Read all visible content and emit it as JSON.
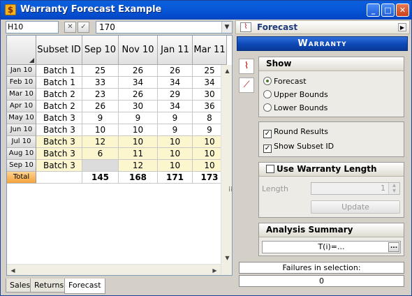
{
  "window": {
    "title": "Warranty Forecast Example",
    "minimize": "_",
    "maximize": "□",
    "close": "✕"
  },
  "formula_bar": {
    "cell_ref": "H10",
    "cancel": "✕",
    "accept": "✓",
    "value": "170"
  },
  "sheet": {
    "columns": [
      "Subset ID",
      "Sep 10",
      "Nov 10",
      "Jan 11",
      "Mar 11"
    ],
    "rows": [
      {
        "label": "Jan 10",
        "cells": [
          "Batch 1",
          "25",
          "26",
          "26",
          "25"
        ]
      },
      {
        "label": "Feb 10",
        "cells": [
          "Batch 1",
          "33",
          "34",
          "34",
          "34"
        ]
      },
      {
        "label": "Mar 10",
        "cells": [
          "Batch 2",
          "23",
          "26",
          "29",
          "30"
        ]
      },
      {
        "label": "Apr 10",
        "cells": [
          "Batch 2",
          "26",
          "30",
          "34",
          "36"
        ]
      },
      {
        "label": "May 10",
        "cells": [
          "Batch 3",
          "9",
          "9",
          "9",
          "8"
        ]
      },
      {
        "label": "Jun 10",
        "cells": [
          "Batch 3",
          "10",
          "10",
          "9",
          "9"
        ]
      },
      {
        "label": "Jul 10",
        "cells": [
          "Batch 3",
          "12",
          "10",
          "10",
          "10"
        ]
      },
      {
        "label": "Aug 10",
        "cells": [
          "Batch 3",
          "6",
          "11",
          "10",
          "10"
        ]
      },
      {
        "label": "Sep 10",
        "cells": [
          "Batch 3",
          "",
          "12",
          "10",
          "10"
        ]
      }
    ],
    "total": {
      "label": "Total",
      "cells": [
        "",
        "145",
        "168",
        "171",
        "173"
      ]
    }
  },
  "sheet_tabs": [
    "Sales",
    "Returns",
    "Forecast"
  ],
  "panel": {
    "title": "Forecast",
    "banner": "Warranty",
    "show": {
      "title": "Show",
      "options": [
        "Forecast",
        "Upper Bounds",
        "Lower Bounds"
      ],
      "selected": "Forecast"
    },
    "round_results": "Round Results",
    "show_subset_id": "Show Subset ID",
    "use_warranty_length": {
      "title": "Use Warranty Length",
      "length_label": "Length",
      "length_value": "1",
      "update_button": "Update"
    },
    "analysis_summary": {
      "title": "Analysis Summary",
      "value": "T(i)=...",
      "more": "..."
    },
    "failures_label": "Failures in selection:",
    "failures_value": "0"
  },
  "colors": {
    "title_bar": "#0a5fdc",
    "highlight": "#fcf6cf",
    "total_row": "#f4a23c",
    "banner": "#0f4ab8"
  }
}
